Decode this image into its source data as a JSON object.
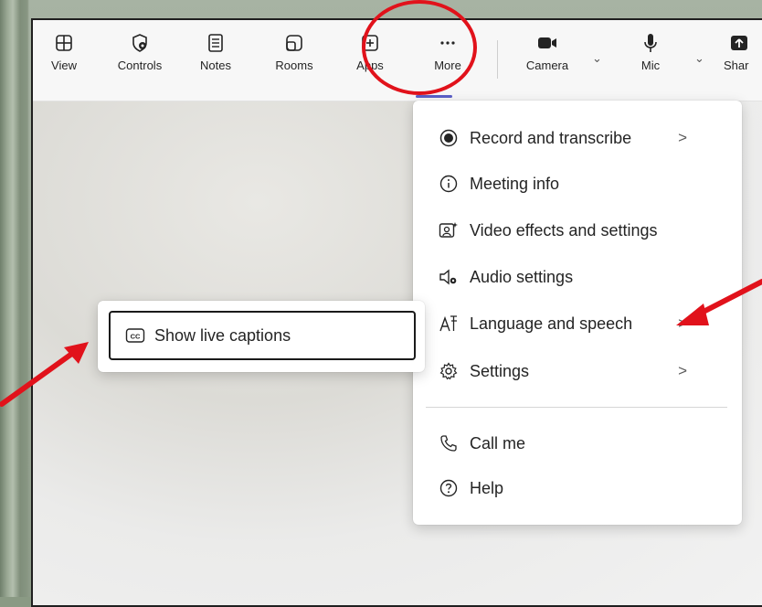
{
  "toolbar": {
    "items": [
      {
        "label": "View",
        "icon": "grid-view-icon"
      },
      {
        "label": "Controls",
        "icon": "shield-gear-icon"
      },
      {
        "label": "Notes",
        "icon": "notes-icon"
      },
      {
        "label": "Rooms",
        "icon": "rooms-icon"
      },
      {
        "label": "Apps",
        "icon": "plus-square-icon"
      },
      {
        "label": "More",
        "icon": "ellipsis-icon"
      },
      {
        "label": "Camera",
        "icon": "camera-icon"
      },
      {
        "label": "Mic",
        "icon": "mic-icon"
      },
      {
        "label": "Shar",
        "icon": "share-icon"
      }
    ]
  },
  "more_menu": {
    "items": [
      {
        "label": "Record and transcribe",
        "icon": "record-icon",
        "has_submenu": true
      },
      {
        "label": "Meeting info",
        "icon": "info-icon",
        "has_submenu": false
      },
      {
        "label": "Video effects and settings",
        "icon": "video-effects-icon",
        "has_submenu": false
      },
      {
        "label": "Audio settings",
        "icon": "speaker-gear-icon",
        "has_submenu": false
      },
      {
        "label": "Language and speech",
        "icon": "language-icon",
        "has_submenu": true
      },
      {
        "label": "Settings",
        "icon": "gear-icon",
        "has_submenu": true
      },
      {
        "label": "Call me",
        "icon": "phone-icon",
        "has_submenu": false
      },
      {
        "label": "Help",
        "icon": "help-icon",
        "has_submenu": false
      }
    ],
    "submenu_arrow": ">"
  },
  "language_submenu": {
    "items": [
      {
        "label": "Show live captions",
        "icon": "cc-icon"
      }
    ]
  },
  "colors": {
    "accent": "#5b5fc7",
    "annotation_red": "#e1121b"
  }
}
